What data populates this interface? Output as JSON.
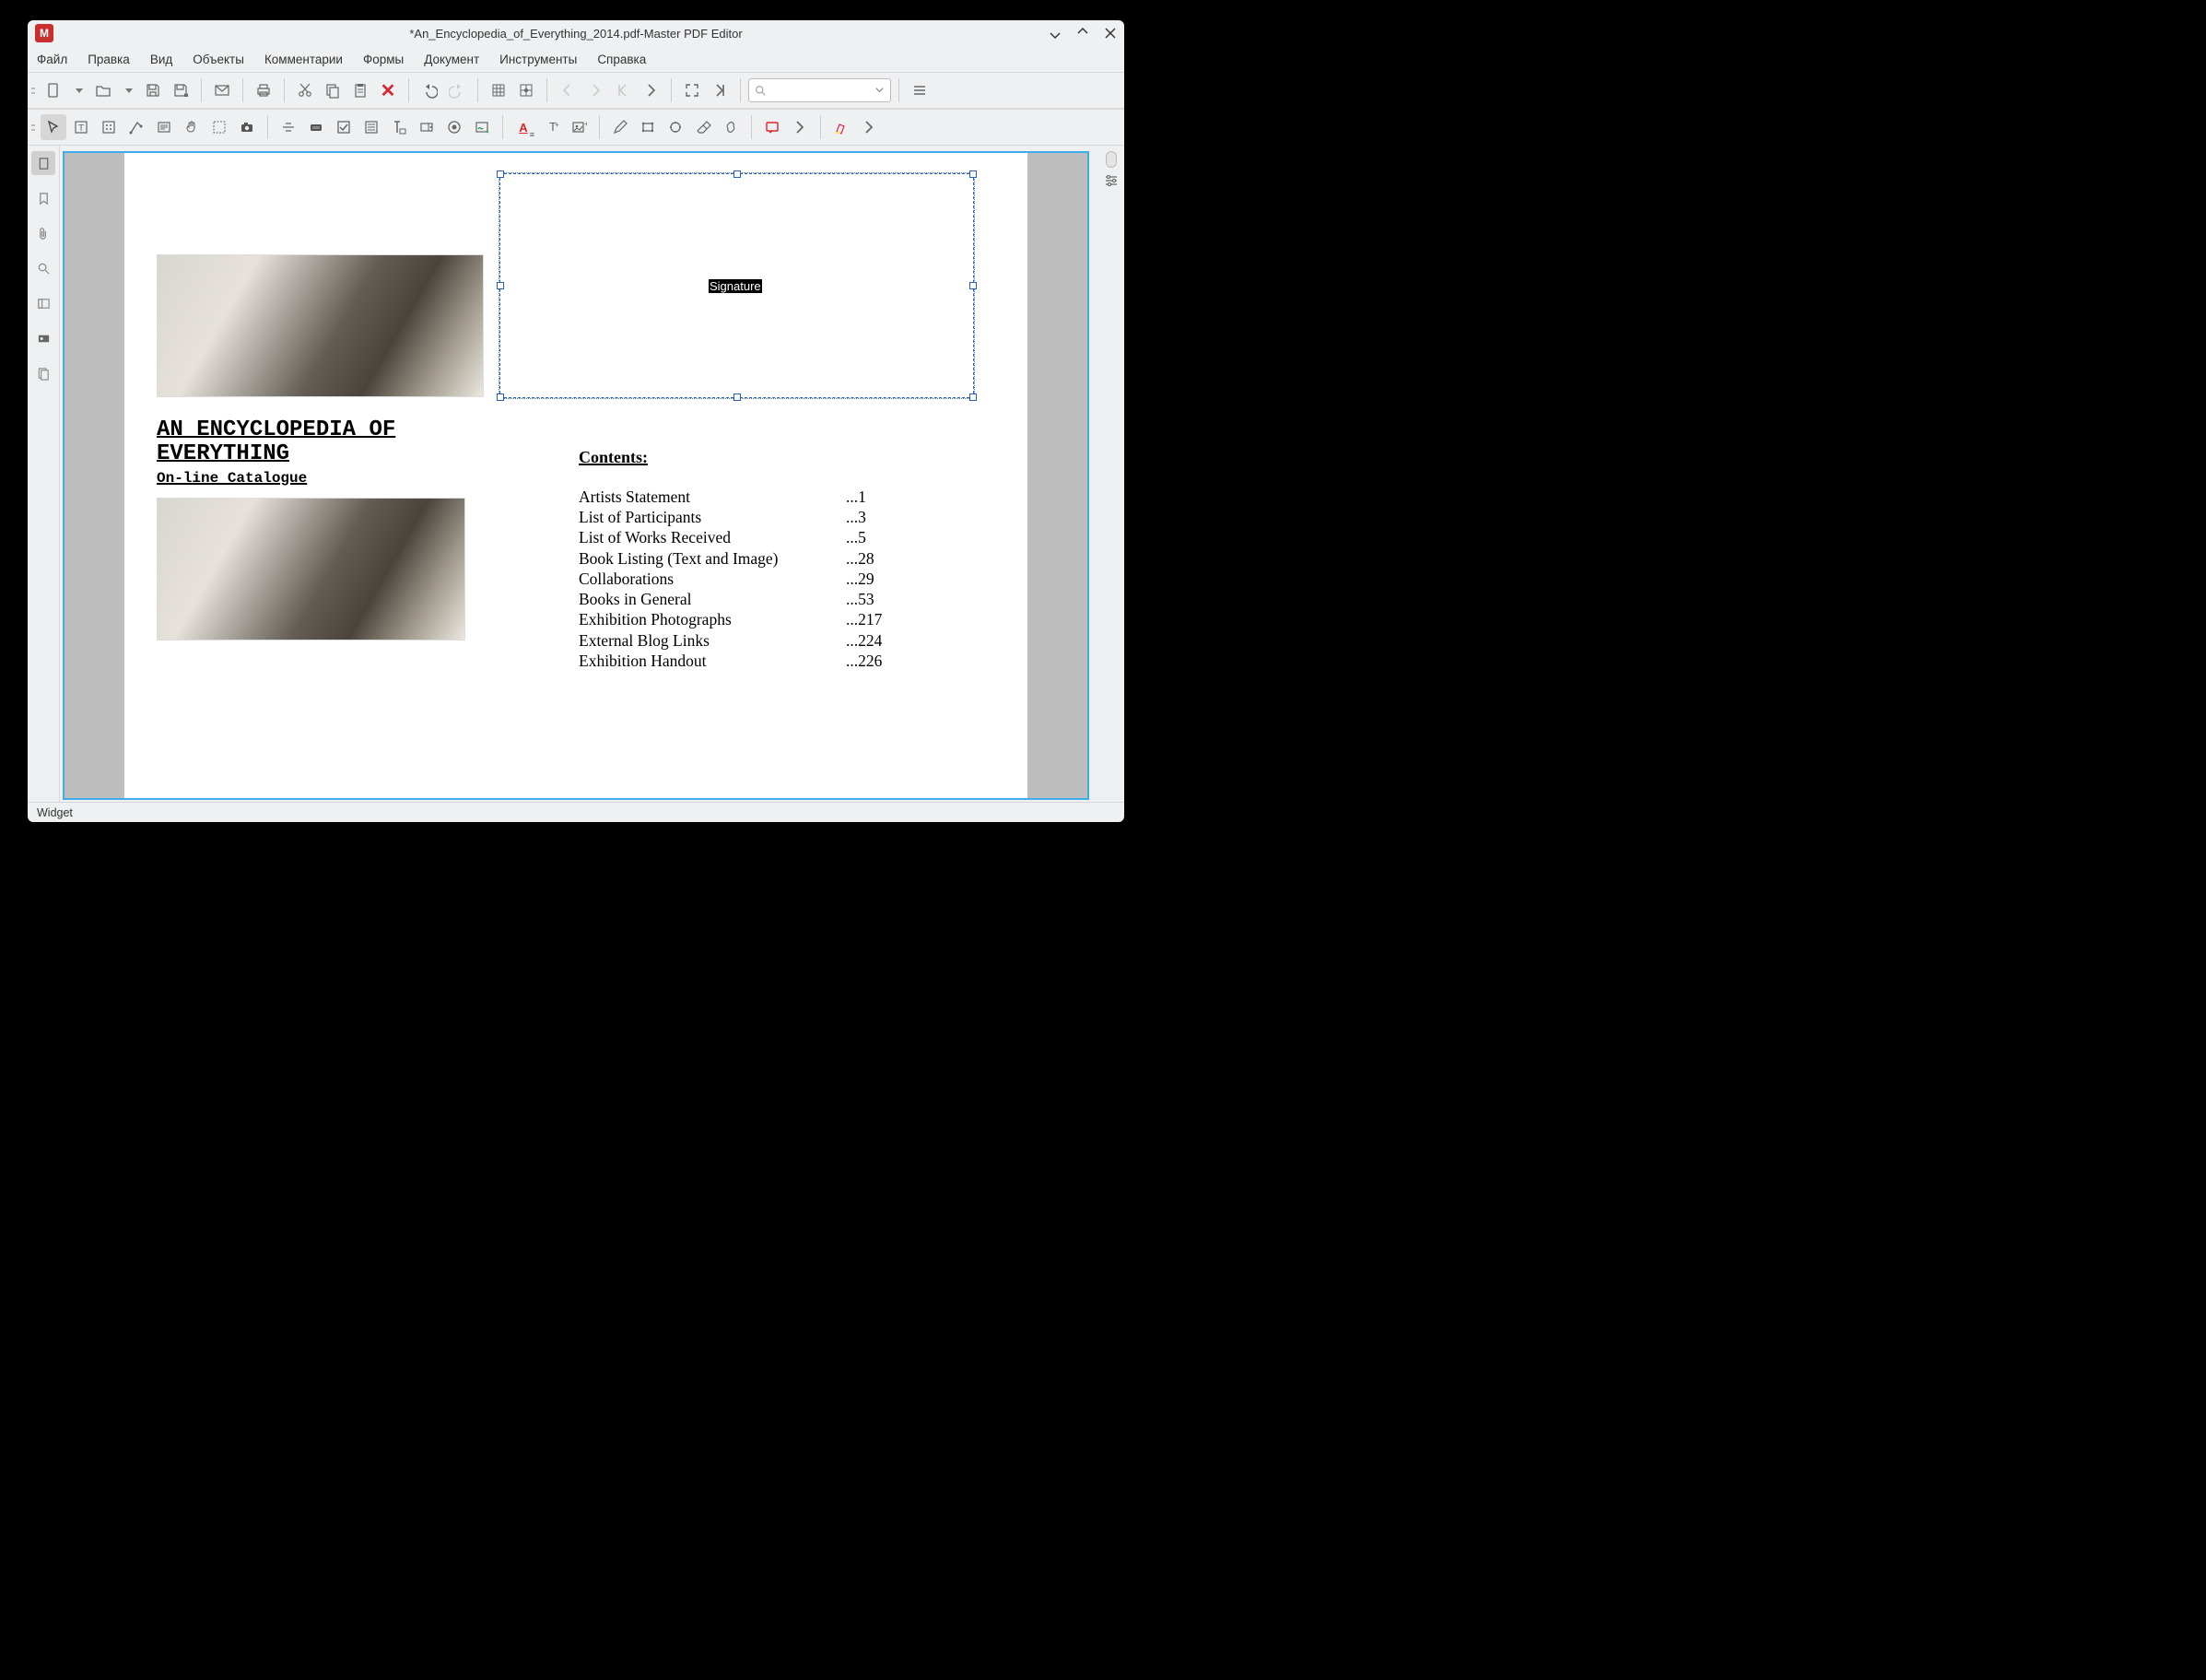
{
  "titlebar": {
    "title": "*An_Encyclopedia_of_Everything_2014.pdf-Master PDF Editor"
  },
  "menu": {
    "file": "Файл",
    "edit": "Правка",
    "view": "Вид",
    "objects": "Объекты",
    "comments": "Комментарии",
    "forms": "Формы",
    "document": "Документ",
    "tools": "Инструменты",
    "help": "Справка"
  },
  "search": {
    "placeholder": ""
  },
  "document": {
    "title_line1": "AN ENCYCLOPEDIA OF",
    "title_line2": "EVERYTHING",
    "subtitle": "On-line Catalogue",
    "contents_heading": "Contents:",
    "contents": [
      {
        "label": "Artists Statement",
        "page": "...1"
      },
      {
        "label": "List of Participants",
        "page": "...3"
      },
      {
        "label": "List of Works Received",
        "page": "...5"
      },
      {
        "label": "Book Listing (Text and Image)",
        "page": "...28"
      },
      {
        "label": "Collaborations",
        "page": "...29"
      },
      {
        "label": "Books in General",
        "page": "...53"
      },
      {
        "label": "Exhibition Photographs",
        "page": "...217"
      },
      {
        "label": "External Blog Links",
        "page": "...224"
      },
      {
        "label": "Exhibition Handout",
        "page": "...226"
      }
    ],
    "signature_label": "Signature"
  },
  "statusbar": {
    "text": "Widget"
  }
}
